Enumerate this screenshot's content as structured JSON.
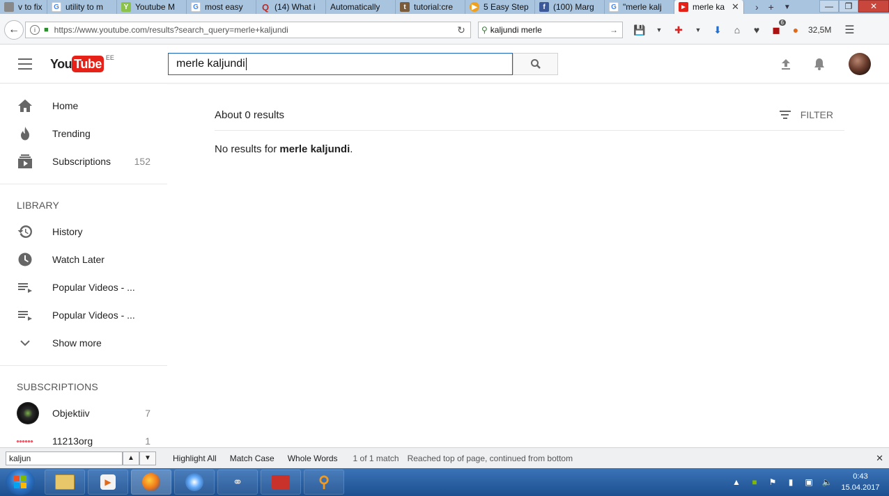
{
  "browser": {
    "tabs": [
      {
        "title": "v to fix",
        "favicon": "page-icon",
        "color": "#888888"
      },
      {
        "title": "utility to m",
        "favicon": "google-icon",
        "color": "#4285f4"
      },
      {
        "title": "Youtube M",
        "favicon": "generic-site-icon",
        "color": "#8bc34a"
      },
      {
        "title": "most easy",
        "favicon": "google-icon",
        "color": "#4285f4"
      },
      {
        "title": "(14) What i",
        "favicon": "quora-icon",
        "color": "#b92b27"
      },
      {
        "title": "Automatically",
        "favicon": "blank-icon",
        "color": "#cccccc"
      },
      {
        "title": "tutorial:cre",
        "favicon": "wiki-icon",
        "color": "#7a5c3a"
      },
      {
        "title": "5 Easy Step",
        "favicon": "play-icon",
        "color": "#f0a020"
      },
      {
        "title": "(100) Marg",
        "favicon": "facebook-icon",
        "color": "#3b5998"
      },
      {
        "title": "\"merle kalj",
        "favicon": "google-icon",
        "color": "#4285f4"
      },
      {
        "title": "merle ka",
        "favicon": "youtube-icon",
        "color": "#e62117",
        "active": true
      }
    ],
    "url": "https://www.youtube.com/results?search_query=merle+kaljundi",
    "search_value": "kaljundi merle",
    "memory_label": "32,5M",
    "ublock_badge": "6"
  },
  "youtube": {
    "logo_you": "You",
    "logo_tube": "Tube",
    "country_code": "EE",
    "search_value": "merle kaljundi",
    "nav": [
      {
        "label": "Home",
        "icon": "home-icon"
      },
      {
        "label": "Trending",
        "icon": "flame-icon"
      },
      {
        "label": "Subscriptions",
        "icon": "subscriptions-icon",
        "count": "152"
      }
    ],
    "library_heading": "LIBRARY",
    "library": [
      {
        "label": "History",
        "icon": "history-icon"
      },
      {
        "label": "Watch Later",
        "icon": "clock-icon"
      },
      {
        "label": "Popular Videos - ...",
        "icon": "playlist-icon"
      },
      {
        "label": "Popular Videos - ...",
        "icon": "playlist-icon"
      },
      {
        "label": "Show more",
        "icon": "chevron-down-icon"
      }
    ],
    "subscriptions_heading": "SUBSCRIPTIONS",
    "subscriptions": [
      {
        "label": "Objektiiv",
        "count": "7"
      },
      {
        "label": "11213org",
        "count": "1"
      }
    ],
    "results_count": "About 0 results",
    "filter_label": "FILTER",
    "no_results_prefix": "No results for ",
    "no_results_query": "merle kaljundi",
    "no_results_suffix": "."
  },
  "findbar": {
    "value": "kaljun",
    "highlight_all": "Highlight All",
    "match_case": "Match Case",
    "whole_words": "Whole Words",
    "status": "1 of 1 match",
    "message": "Reached top of page, continued from bottom"
  },
  "taskbar": {
    "time": "0:43",
    "date": "15.04.2017"
  }
}
